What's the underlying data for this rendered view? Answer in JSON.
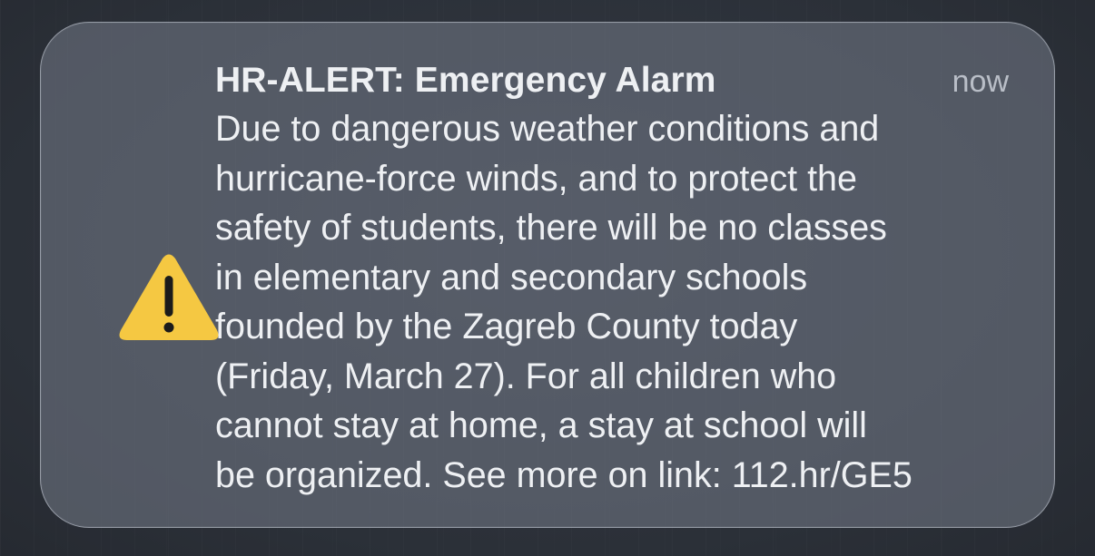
{
  "notification": {
    "icon": "warning-triangle-icon",
    "icon_color": "#f5c842",
    "title": "HR-ALERT: Emergency Alarm",
    "timestamp": "now",
    "body_lines": [
      "Due to dangerous weather conditions and",
      "hurricane-force winds, and to protect the",
      "safety of students, there will be no classes",
      "in elementary and secondary schools",
      "founded by the Zagreb County today",
      "(Friday, March 27). For all children who",
      "cannot stay at home, a stay at school will",
      "be organized. See more on link: 112.hr/GE5"
    ]
  }
}
